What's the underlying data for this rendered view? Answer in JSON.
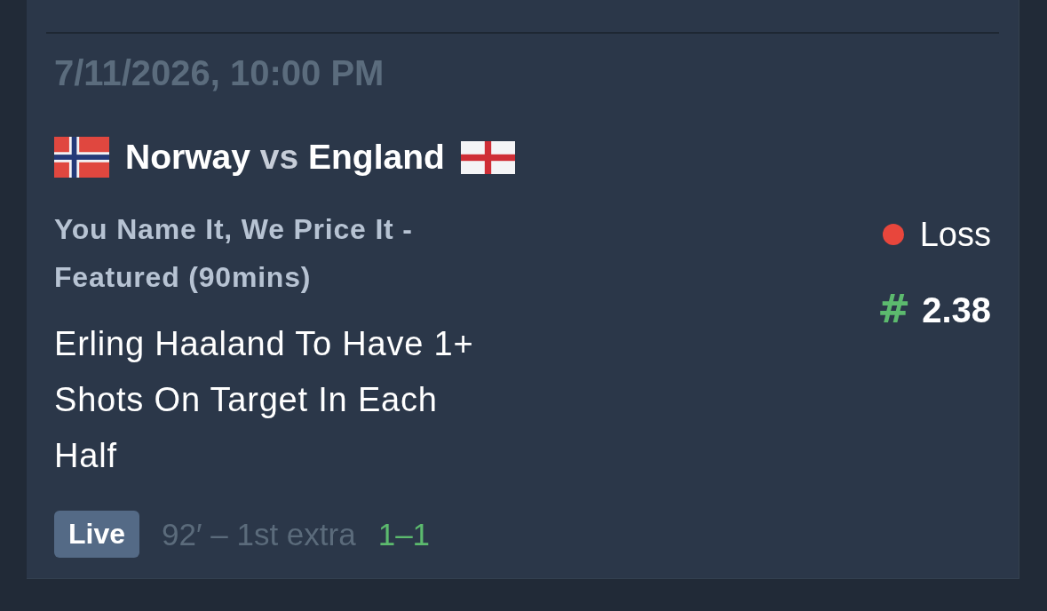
{
  "bet": {
    "date": "7/11/2026, 10:00 PM",
    "match": {
      "home": "Norway",
      "separator": "vs",
      "away": "England"
    },
    "market": "You Name It, We Price It - Featured (90mins)",
    "selection": "Erling Haaland To Have 1+ Shots On Target In Each Half",
    "result": {
      "label": "Loss",
      "color": "#e8463c"
    },
    "odds": {
      "symbol": "#",
      "value": "2.38"
    },
    "live": {
      "badge": "Live",
      "clock": "92′ – 1st extra",
      "score": "1–1"
    }
  }
}
